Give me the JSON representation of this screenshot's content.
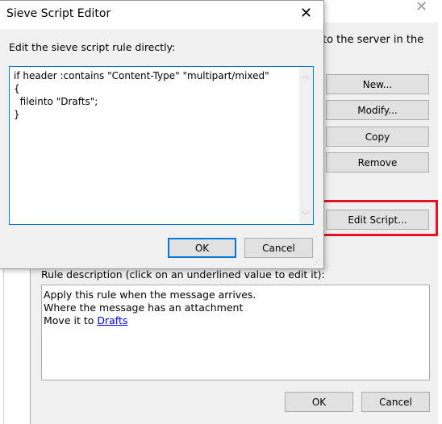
{
  "background_window": {
    "partial_text": "to the server in the",
    "buttons": {
      "new": "New...",
      "modify": "Modify...",
      "copy": "Copy",
      "remove": "Remove",
      "edit_script": "Edit Script..."
    },
    "rule_description_label": "Rule description (click on an underlined value to edit it):",
    "rule_lines": [
      "Apply this rule when the message arrives.",
      "Where the message has an attachment",
      "Move it to "
    ],
    "rule_link": "Drafts",
    "ok": "OK",
    "cancel": "Cancel",
    "highlight_color": "#e81123"
  },
  "dialog": {
    "title": "Sieve Script Editor",
    "label": "Edit the sieve script rule directly:",
    "script": "if header :contains \"Content-Type\" \"multipart/mixed\"\n{\n  fileinto \"Drafts\";\n}",
    "ok": "OK",
    "cancel": "Cancel"
  }
}
